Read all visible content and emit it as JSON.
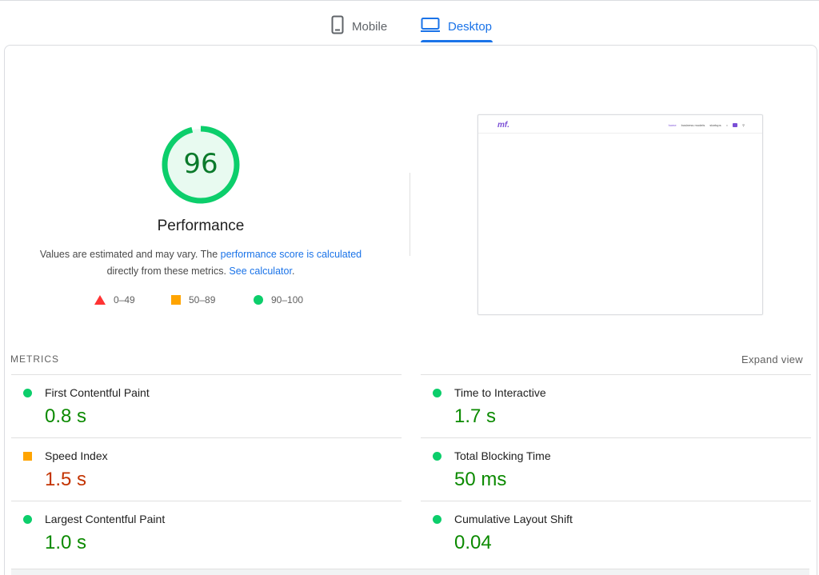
{
  "tabs": [
    {
      "label": "Mobile",
      "icon": "smartphone-icon",
      "active": false
    },
    {
      "label": "Desktop",
      "icon": "desktop-icon",
      "active": true
    }
  ],
  "gauge": {
    "score": "96",
    "score_value": 96,
    "color": "#0cce6b"
  },
  "performance": {
    "title": "Performance",
    "desc_prefix": "Values are estimated and may vary. The ",
    "desc_link1": "performance score is calculated",
    "desc_middle": " directly from these metrics. ",
    "desc_link2": "See calculator",
    "desc_suffix": "."
  },
  "legend": [
    {
      "range": "0–49",
      "shape": "triangle",
      "color": "#ff3333"
    },
    {
      "range": "50–89",
      "shape": "square",
      "color": "#ffa400"
    },
    {
      "range": "90–100",
      "shape": "circle",
      "color": "#0cce6b"
    }
  ],
  "screenshot": {
    "logo": "mf.",
    "nav": [
      "home",
      "business models",
      "startups"
    ]
  },
  "metrics": {
    "header": "METRICS",
    "expand": "Expand view",
    "left": [
      {
        "name": "First Contentful Paint",
        "value": "0.8 s",
        "status": "good"
      },
      {
        "name": "Speed Index",
        "value": "1.5 s",
        "status": "average"
      },
      {
        "name": "Largest Contentful Paint",
        "value": "1.0 s",
        "status": "good"
      }
    ],
    "right": [
      {
        "name": "Time to Interactive",
        "value": "1.7 s",
        "status": "good"
      },
      {
        "name": "Total Blocking Time",
        "value": "50 ms",
        "status": "good"
      },
      {
        "name": "Cumulative Layout Shift",
        "value": "0.04",
        "status": "good"
      }
    ]
  },
  "colors": {
    "accent": "#1a73e8",
    "good": "#0b8a00",
    "average": "#c33300"
  }
}
